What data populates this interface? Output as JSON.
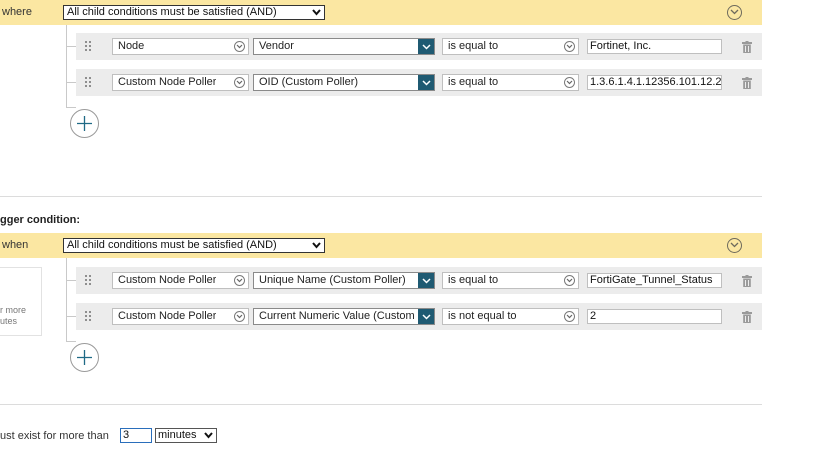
{
  "group1": {
    "label": "where",
    "logic_select": "All child conditions must be satisfied (AND)",
    "conditions": [
      {
        "object": "Node",
        "field": "Vendor",
        "operator": "is equal to",
        "value": "Fortinet, Inc."
      },
      {
        "object": "Custom Node Poller",
        "field": "OID (Custom Poller)",
        "operator": "is equal to",
        "value": "1.3.6.1.4.1.12356.101.12.2."
      }
    ]
  },
  "trigger": {
    "title": "gger condition:",
    "group_label": "when",
    "logic_select": "All child conditions must be satisfied (AND)",
    "side_note": [
      "r more",
      "utes"
    ],
    "conditions": [
      {
        "object": "Custom Node Poller",
        "field": "Unique Name (Custom Poller)",
        "operator": "is equal to",
        "value": "FortiGate_Tunnel_Status"
      },
      {
        "object": "Custom Node Poller",
        "field": "Current Numeric Value (Custom Poller)",
        "operator": "is not equal to",
        "value": "2"
      }
    ]
  },
  "duration": {
    "label": "ust exist for more than",
    "value": "3",
    "unit": "minutes"
  },
  "icons": {
    "drag": "drag-handle-icon",
    "dropdown": "chevron-down-icon",
    "trash": "trash-icon",
    "add": "plus-icon",
    "collapse": "chevron-circle-icon"
  },
  "colors": {
    "group_bar": "#fbe7a2",
    "row_bg": "#ececec",
    "dark_button": "#1f5a72",
    "focus_border": "#2a6ebb"
  }
}
